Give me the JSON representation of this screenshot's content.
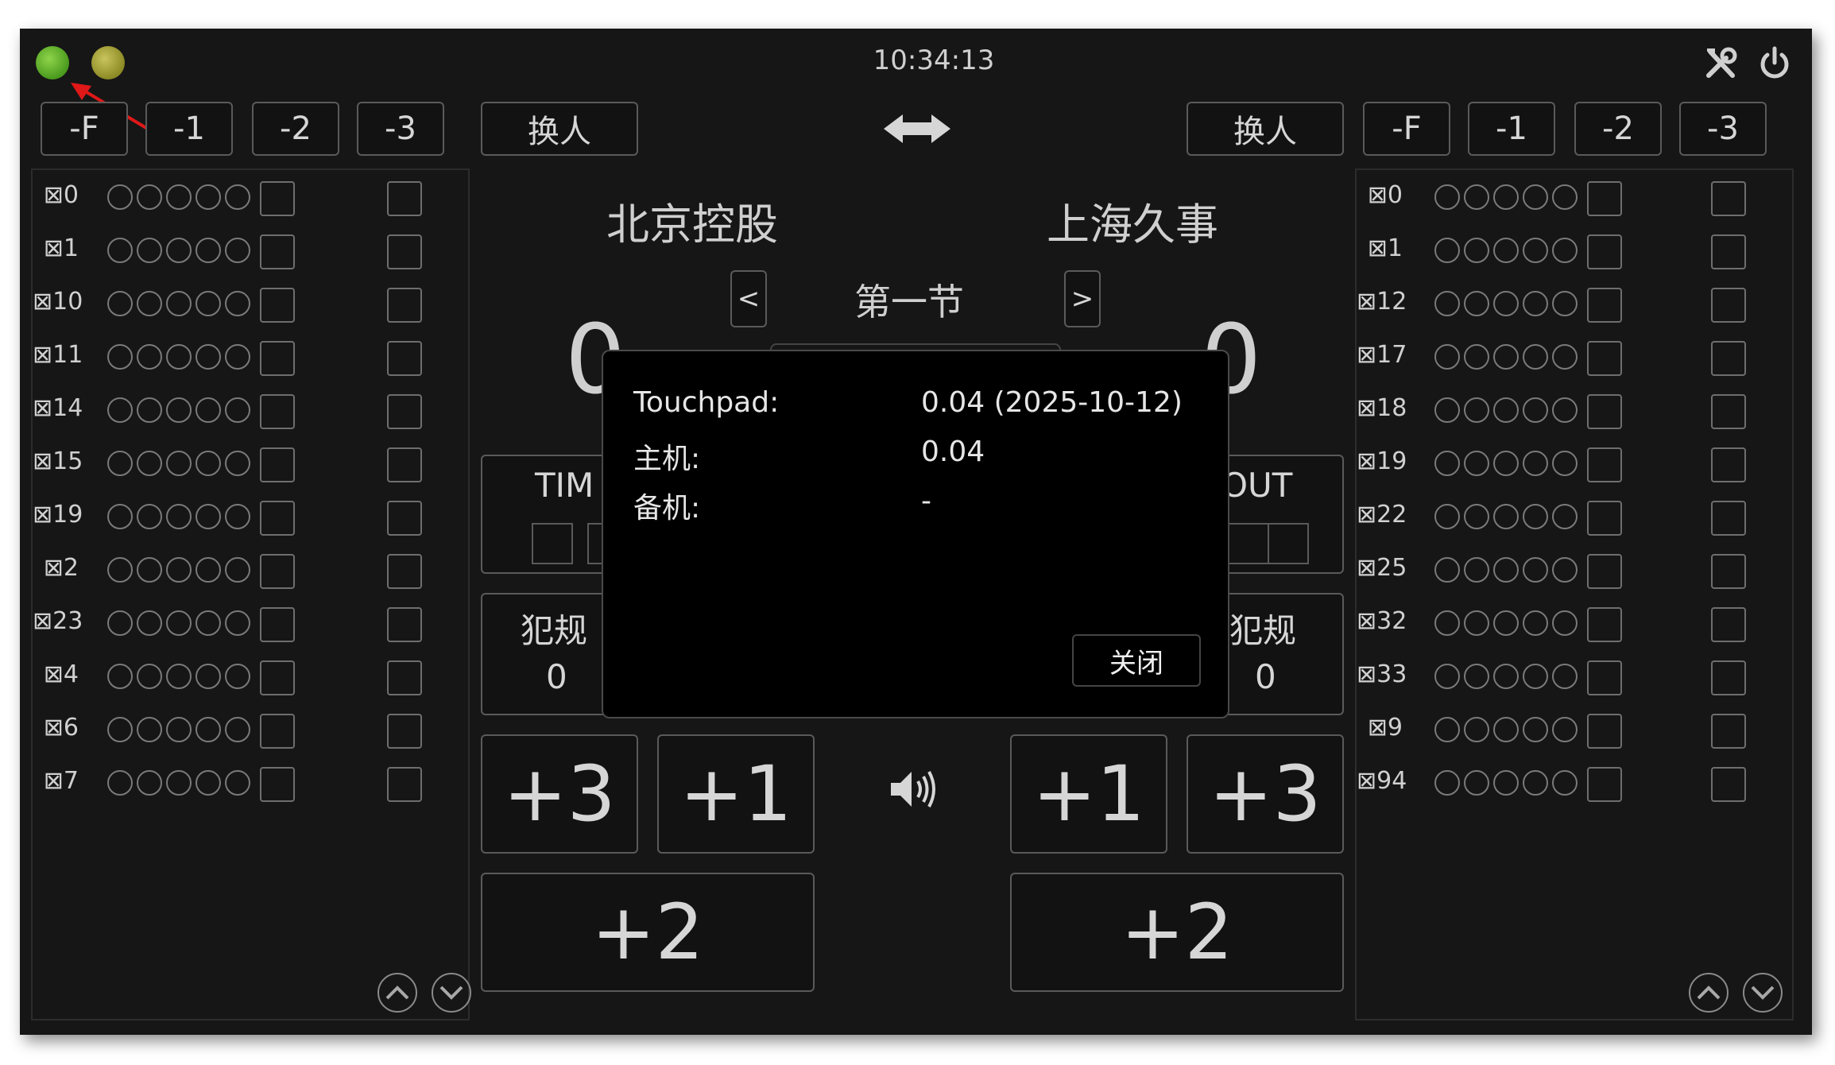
{
  "topbar": {
    "clock": "10:34:13"
  },
  "left_bar": {
    "buttons": [
      "-F",
      "-1",
      "-2",
      "-3"
    ],
    "swap": "换人"
  },
  "right_bar": {
    "buttons": [
      "-F",
      "-1",
      "-2",
      "-3"
    ],
    "swap": "换人"
  },
  "icons": {
    "direction": "double-arrow-icon",
    "tools": "tools-icon",
    "power": "power-icon",
    "sound": "speaker-icon",
    "up": "chevron-up-icon",
    "down": "chevron-down-icon"
  },
  "left_players": [
    {
      "num": "⊠0"
    },
    {
      "num": "⊠1"
    },
    {
      "num": "⊠10"
    },
    {
      "num": "⊠11"
    },
    {
      "num": "⊠14"
    },
    {
      "num": "⊠15"
    },
    {
      "num": "⊠19"
    },
    {
      "num": "⊠2"
    },
    {
      "num": "⊠23"
    },
    {
      "num": "⊠4"
    },
    {
      "num": "⊠6"
    },
    {
      "num": "⊠7"
    }
  ],
  "right_players": [
    {
      "num": "⊠0"
    },
    {
      "num": "⊠1"
    },
    {
      "num": "⊠12"
    },
    {
      "num": "⊠17"
    },
    {
      "num": "⊠18"
    },
    {
      "num": "⊠19"
    },
    {
      "num": "⊠22"
    },
    {
      "num": "⊠25"
    },
    {
      "num": "⊠32"
    },
    {
      "num": "⊠33"
    },
    {
      "num": "⊠9"
    },
    {
      "num": "⊠94"
    }
  ],
  "game": {
    "home_team": "北京控股",
    "away_team": "上海久事",
    "period": "第一节",
    "prev": "<",
    "next": ">",
    "home_score": "0",
    "away_score": "0",
    "timeout_left": "TIM",
    "timeout_right": "OUT",
    "foul_label": "犯规",
    "home_fouls": "0",
    "away_fouls": "0"
  },
  "score_buttons": {
    "plus3": "+3",
    "plus1": "+1",
    "plus2": "+2"
  },
  "dialog": {
    "rows": [
      {
        "label": "Touchpad:",
        "value": "0.04 (2025-10-12)"
      },
      {
        "label": "主机:",
        "value": "0.04"
      },
      {
        "label": "备机:",
        "value": "-"
      }
    ],
    "close": "关闭"
  }
}
